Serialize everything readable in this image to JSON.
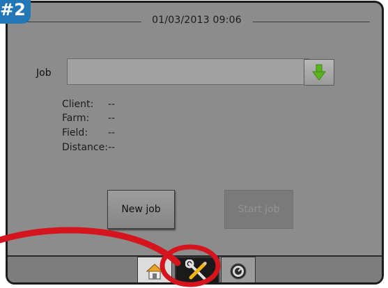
{
  "badge": {
    "label": "#2"
  },
  "header": {
    "datetime": "01/03/2013 09:06"
  },
  "job": {
    "label": "Job",
    "value": "",
    "download_icon": "green-down-arrow-icon"
  },
  "details": [
    {
      "key": "Client:",
      "value": "--"
    },
    {
      "key": "Farm:",
      "value": "--"
    },
    {
      "key": "Field:",
      "value": "--"
    },
    {
      "key": "Distance:",
      "value": "--"
    }
  ],
  "buttons": {
    "new_job": "New job",
    "start_job": "Start job"
  },
  "tabs": [
    {
      "name": "home",
      "icon": "home-icon"
    },
    {
      "name": "tools",
      "icon": "wrench-screwdriver-icon",
      "selected": true
    },
    {
      "name": "gauge",
      "icon": "gauge-icon"
    }
  ],
  "colors": {
    "screen_bg": "#8c8c8c",
    "badge": "#2477b6",
    "annotation": "#d4151e",
    "download_arrow": "#5cb31d"
  }
}
